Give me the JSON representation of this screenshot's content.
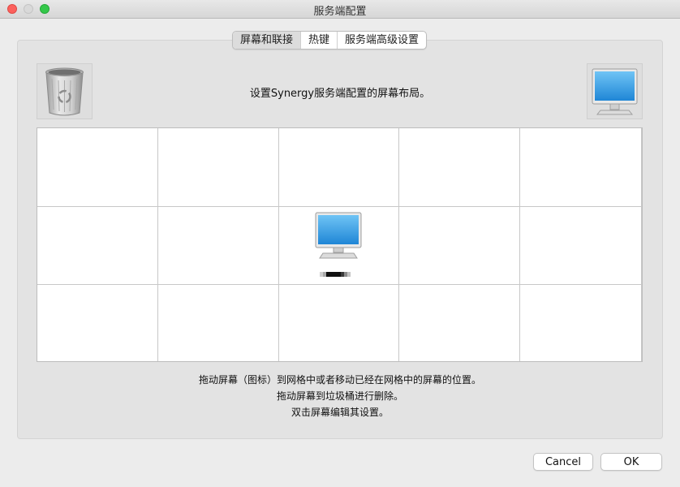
{
  "window": {
    "title": "服务端配置"
  },
  "tabs": [
    {
      "label": "屏幕和联接",
      "active": true
    },
    {
      "label": "热键",
      "active": false
    },
    {
      "label": "服务端高级设置",
      "active": false
    }
  ],
  "main": {
    "layout_description": "设置Synergy服务端配置的屏幕布局。",
    "instructions": [
      "拖动屏幕（图标）到网格中或者移动已经在网格中的屏幕的位置。",
      "拖动屏幕到垃圾桶进行删除。",
      "双击屏幕编辑其设置。"
    ]
  },
  "buttons": {
    "cancel": "Cancel",
    "ok": "OK"
  }
}
